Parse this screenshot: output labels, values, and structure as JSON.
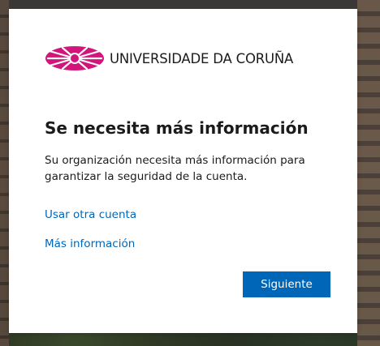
{
  "background": {
    "description_color": "#3a3836"
  },
  "logo": {
    "icon": "udc-logo-icon",
    "text": "UNIVERSIDADE DA CORUÑA",
    "color": "#d1157a"
  },
  "dialog": {
    "title": "Se necesita más información",
    "description": "Su organización necesita más información para garantizar la seguridad de la cuenta.",
    "links": {
      "other_account": "Usar otra cuenta",
      "more_info": "Más información"
    },
    "next_button_label": "Siguiente"
  },
  "colors": {
    "primary": "#0067b8",
    "link": "#0067b8",
    "text": "#1b1b1b",
    "card": "#ffffff"
  }
}
